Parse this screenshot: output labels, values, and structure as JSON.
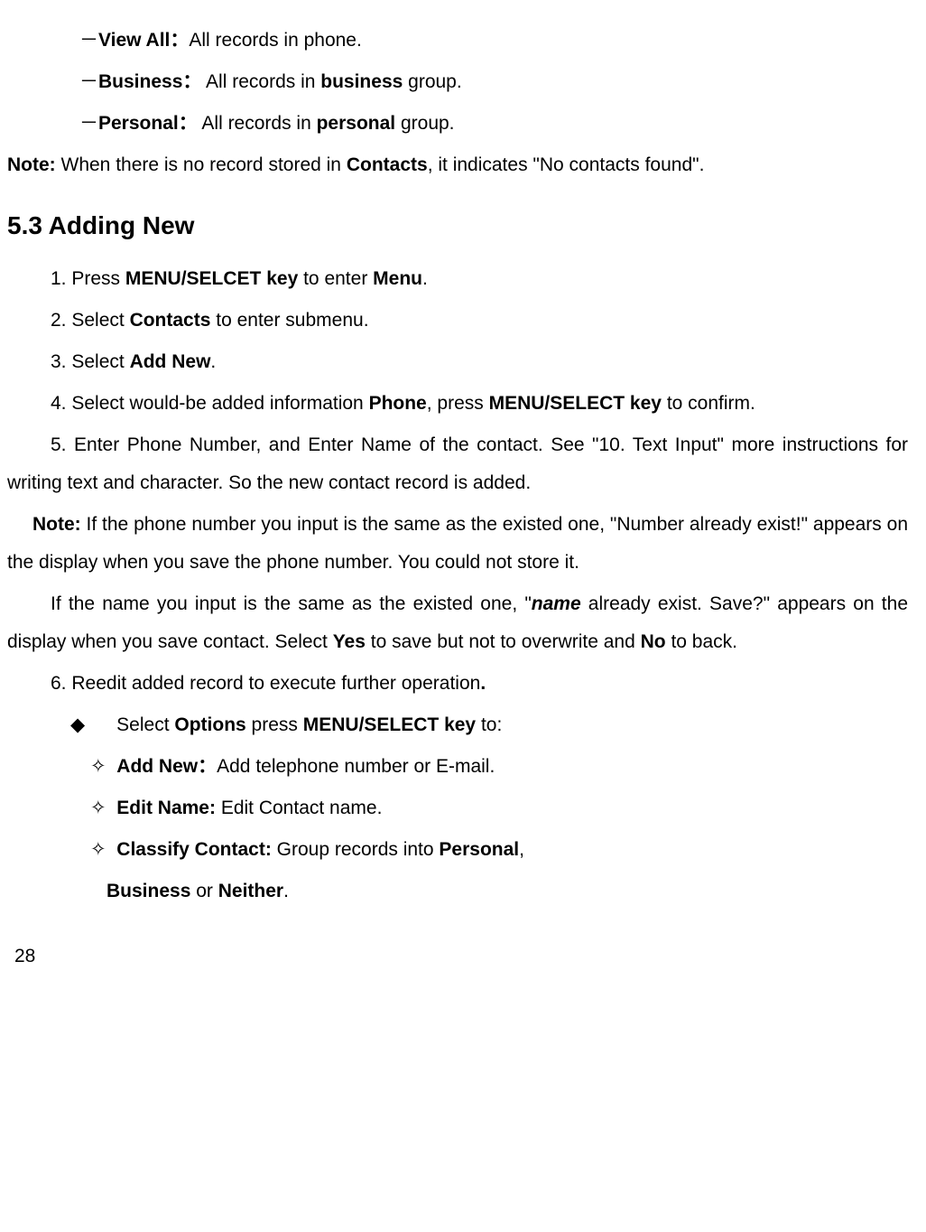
{
  "line1": {
    "dash": "－",
    "label": "View All：",
    "text": "All records in phone."
  },
  "line2": {
    "dash": "－",
    "label": "Business：",
    "text_a": " All records in ",
    "bold": "business",
    "text_b": " group."
  },
  "line3": {
    "dash": "－",
    "label": "Personal：",
    "text_a": " All records in ",
    "bold": "personal",
    "text_b": " group."
  },
  "note1": {
    "label": "Note: ",
    "text_a": "When there is no record stored in ",
    "bold": "Contacts",
    "text_b": ", it indicates \"No contacts found\"."
  },
  "heading": "5.3 Adding New",
  "step1": {
    "num": "1. ",
    "a": "Press ",
    "b1": "MENU/SELCET key",
    "b": " to enter ",
    "b2": "Menu",
    "c": "."
  },
  "step2": {
    "num": "2. ",
    "a": "Select ",
    "b1": "Contacts",
    "b": " to enter submenu."
  },
  "step3": {
    "num": "3. ",
    "a": "Select ",
    "b1": "Add New",
    "b": "."
  },
  "step4": {
    "num": "4. ",
    "a": "Select would-be added information ",
    "b1": "Phone",
    "b": ", press ",
    "b2": "MENU/SELECT key",
    "c": " to confirm."
  },
  "step5": {
    "num": "5. ",
    "a": "Enter Phone Number, and Enter Name of the contact. See \"10. Text Input\" more instructions for writing text and character. So the new contact record is added."
  },
  "note2": {
    "label": "Note: ",
    "text": "If the phone number you input is the same as the existed one, \"Number already exist!\" appears on the display when you save the phone number. You could not store it."
  },
  "para1": {
    "a": "If the name you input is the same as the existed one, \"",
    "bi": "name",
    "b": " already exist. Save?\" appears on the display when you save contact. Select ",
    "b1": "Yes",
    "c": " to save but not to overwrite and ",
    "b2": "No",
    "d": " to back."
  },
  "step6": {
    "num": "6. ",
    "a": "Reedit added record to execute further operation",
    "b": "."
  },
  "bullet1": {
    "sym": "◆",
    "a": "Select ",
    "b1": "Options",
    "b": " press ",
    "b2": "MENU/SELECT key",
    "c": " to:"
  },
  "sub1": {
    "sym": "✧",
    "b1": "Add New：",
    "a": "Add telephone number or E-mail."
  },
  "sub2": {
    "sym": "✧",
    "b1": "Edit Name: ",
    "a": "Edit Contact name."
  },
  "sub3": {
    "sym": "✧",
    "b1": "Classify Contact: ",
    "a": "Group records into ",
    "b2": "Personal",
    "b": ", ",
    "b3": "Business",
    "c": " or ",
    "b4": "Neither",
    "d": "."
  },
  "page": "28"
}
